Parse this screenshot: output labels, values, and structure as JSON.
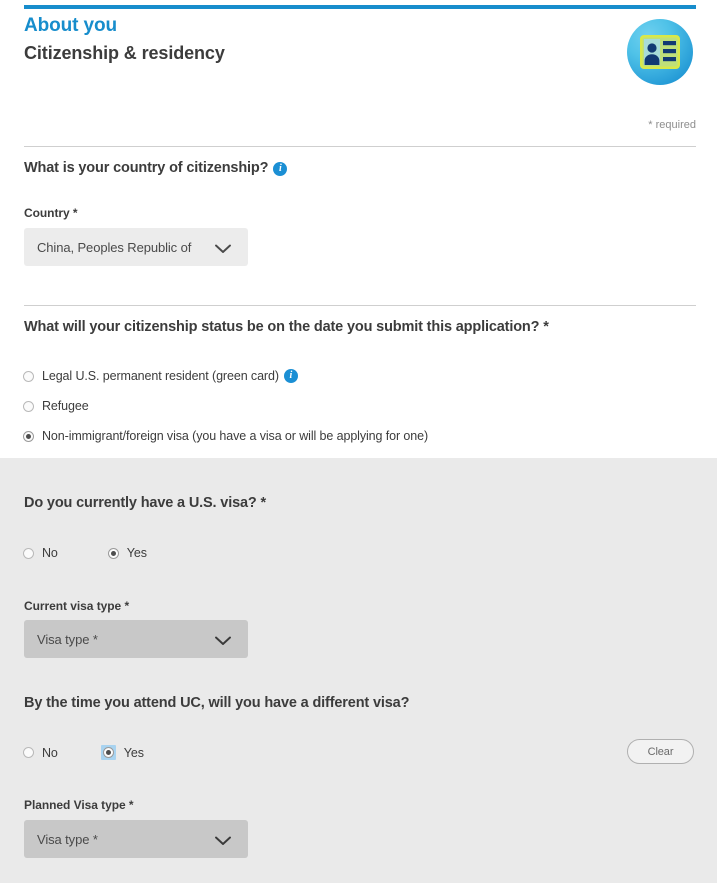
{
  "header": {
    "eyebrow": "About you",
    "title": "Citizenship & residency",
    "badge_icon": "id-card-icon",
    "required_note": "* required",
    "accent_color": "#178dcc"
  },
  "citizenship": {
    "question": "What is your country of citizenship?",
    "info_icon": "i",
    "field_label": "Country *",
    "selected_country": "China, Peoples Republic of"
  },
  "status": {
    "question": "What will your citizenship status be on the date you submit this application? *",
    "options": [
      {
        "label": "Legal U.S. permanent resident (green card)",
        "checked": false,
        "has_info": true
      },
      {
        "label": "Refugee",
        "checked": false,
        "has_info": false
      },
      {
        "label": "Non-immigrant/foreign visa (you have a visa or will be applying for one)",
        "checked": true,
        "has_info": false
      }
    ]
  },
  "current_visa": {
    "question": "Do you currently have a U.S. visa? *",
    "options": [
      {
        "label": "No",
        "checked": false
      },
      {
        "label": "Yes",
        "checked": true
      }
    ],
    "field_label": "Current visa type *",
    "selected_value": "Visa type *"
  },
  "future_visa": {
    "question": "By the time you attend UC, will you have a different visa?",
    "options": [
      {
        "label": "No",
        "checked": false,
        "focused": false
      },
      {
        "label": "Yes",
        "checked": true,
        "focused": true
      }
    ],
    "clear_label": "Clear",
    "field_label": "Planned Visa type *",
    "selected_value": "Visa type *"
  }
}
